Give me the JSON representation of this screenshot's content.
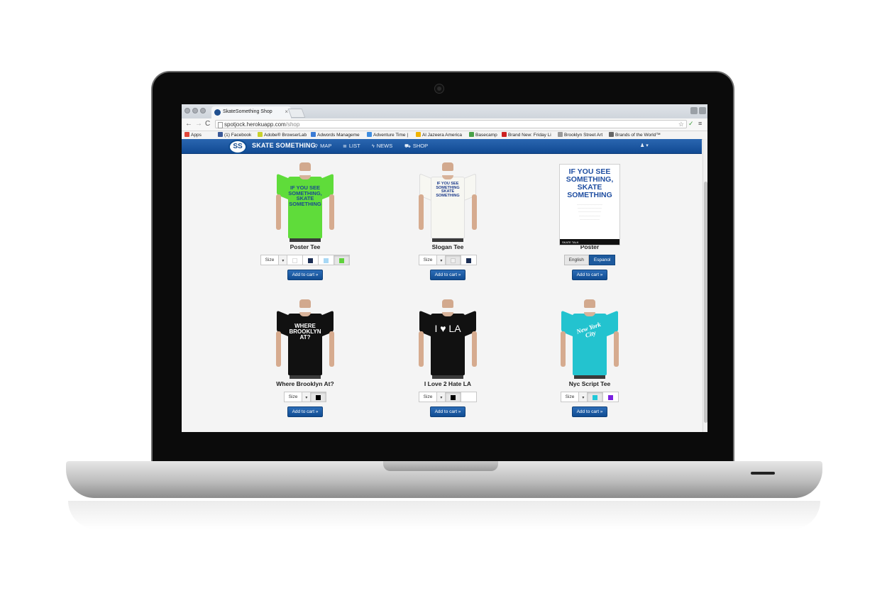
{
  "browser": {
    "tab_title": "SkateSomething Shop",
    "tab_close": "×",
    "url_host": "spotjock.herokuapp.com",
    "url_path": "/shop",
    "nav_back": "←",
    "nav_forward": "→",
    "nav_reload": "C",
    "star": "☆",
    "menu": "≡",
    "bookmarks": [
      {
        "label": "Apps",
        "color": "#e0463a"
      },
      {
        "label": "(1) Facebook",
        "color": "#3b5998"
      },
      {
        "label": "Adobe® BrowserLab",
        "color": "#c8d12c"
      },
      {
        "label": "Adwords Manageme",
        "color": "#3a7bd5"
      },
      {
        "label": "Adventure Time |",
        "color": "#3f8de0"
      },
      {
        "label": "Al Jazeera America",
        "color": "#f0b400"
      },
      {
        "label": "Basecamp",
        "color": "#4aa14a"
      },
      {
        "label": "Brand New: Friday Li",
        "color": "#cc2222"
      },
      {
        "label": "Brooklyn Street Art",
        "color": "#999999"
      },
      {
        "label": "Brands of the World™",
        "color": "#666666"
      }
    ]
  },
  "site": {
    "logo": "SS",
    "brand": "SKATE SOMETHING",
    "nav": [
      {
        "icon": "⚲",
        "label": "MAP"
      },
      {
        "icon": "≣",
        "label": "LIST"
      },
      {
        "icon": "ϟ",
        "label": "NEWS"
      },
      {
        "icon": "⛟",
        "label": "SHOP"
      }
    ],
    "user_menu": "♟ ▾",
    "colors": {
      "nav": "#1a56a0",
      "button": "#1a5aa3"
    }
  },
  "products": [
    {
      "name": "Poster Tee",
      "size_label": "Size",
      "caret": "▾",
      "shirt_color": "#5fdc3a",
      "print": "IF YOU SEE SOMETHING, SKATE SOMETHING",
      "print_color": "#1c4a8f",
      "swatches": [
        {
          "color": "#ffffff"
        },
        {
          "color": "#1c2f55"
        },
        {
          "color": "#a9d8f5"
        },
        {
          "color": "#5fd23c",
          "active": true
        }
      ],
      "cta": "Add to cart »"
    },
    {
      "name": "Slogan Tee",
      "size_label": "Size",
      "caret": "▾",
      "shirt_color": "#f7f7f2",
      "print": "IF YOU SEE SOMETHING SKATE SOMETHING",
      "print_color": "#1f3d8c",
      "swatches": [
        {
          "color": "#f0f0f0",
          "active": true
        },
        {
          "color": "#1c2f55"
        }
      ],
      "cta": "Add to cart »"
    },
    {
      "name": "Poster",
      "poster_head": "IF YOU SEE SOMETHING, SKATE SOMETHING",
      "poster_foot": "SKATE TALK",
      "langs": [
        {
          "label": "English"
        },
        {
          "label": "Espanol",
          "active": true
        }
      ],
      "cta": "Add to cart »"
    },
    {
      "name": "Where Brooklyn At?",
      "size_label": "Size",
      "caret": "▾",
      "shirt_color": "#111111",
      "print": "WHERE BROOKLYN AT?",
      "print_color": "#ffffff",
      "swatches": [
        {
          "color": "#000000",
          "active": true
        }
      ],
      "cta": "Add to cart »"
    },
    {
      "name": "I Love 2 Hate LA",
      "size_label": "Size",
      "caret": "▾",
      "shirt_color": "#111111",
      "print": "I ♥ LA",
      "print_color": "#ffffff",
      "swatches": [
        {
          "color": "#000000",
          "active": true
        },
        {
          "color": "#ffffff"
        }
      ],
      "cta": "Add to cart »"
    },
    {
      "name": "Nyc Script Tee",
      "size_label": "Size",
      "caret": "▾",
      "shirt_color": "#23c3cf",
      "print": "New York City",
      "print_color": "#ffffff",
      "swatches": [
        {
          "color": "#21c8d8",
          "active": true
        },
        {
          "color": "#7a22e0"
        }
      ],
      "cta": "Add to cart »"
    }
  ]
}
